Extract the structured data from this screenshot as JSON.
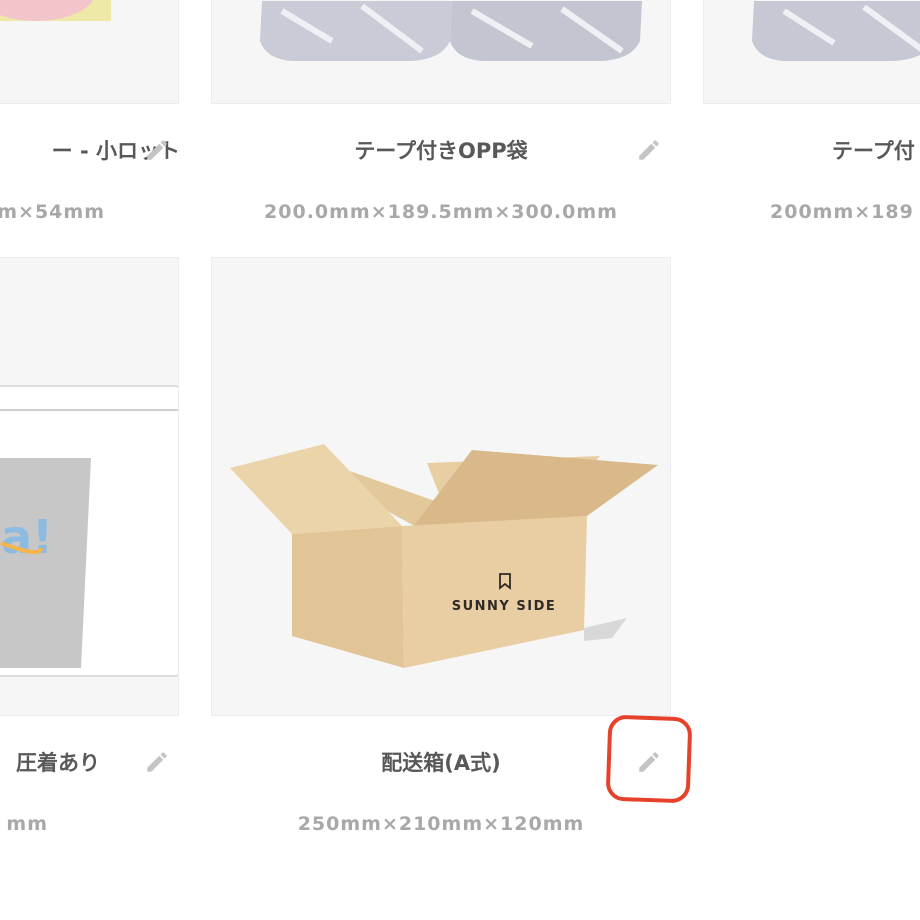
{
  "products": [
    {
      "title": "ー - 小ロット",
      "dims": "m×54mm"
    },
    {
      "title": "テープ付きOPP袋",
      "dims": "200.0mm×189.5mm×300.0mm"
    },
    {
      "title": "テープ付",
      "dims": "200mm×189"
    },
    {
      "title": "圧着あり",
      "dims": "mm"
    },
    {
      "title": "配送箱(A式)",
      "dims": "250mm×210mm×120mm",
      "brand_text": "SUNNY SIDE"
    }
  ],
  "icons": {
    "edit": "pencil-icon"
  },
  "colors": {
    "highlight": "#e6412a",
    "title": "#585858",
    "dims": "#a8a8a8",
    "card_bg": "#f6f6f6"
  }
}
